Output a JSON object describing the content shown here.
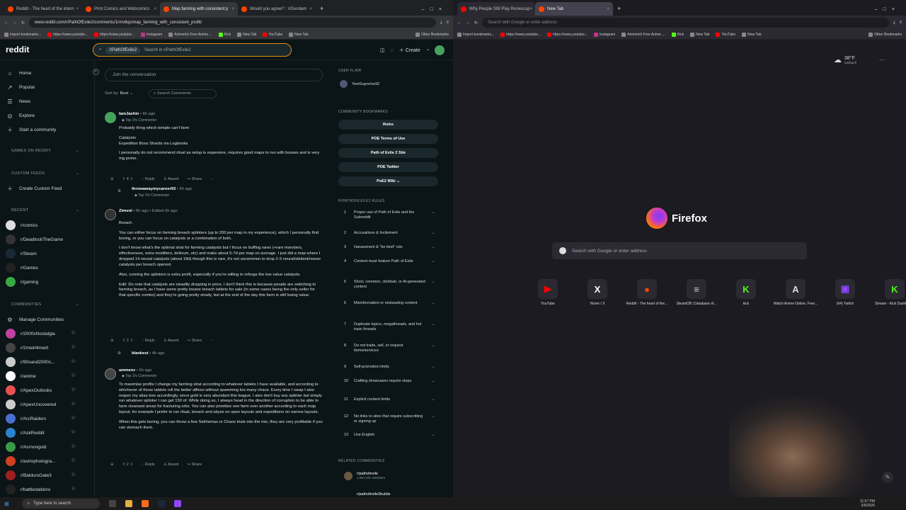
{
  "left_browser": {
    "tabs": [
      {
        "label": "Reddit - The heart of the intern"
      },
      {
        "label": "Print Comics and Webcomics"
      },
      {
        "label": "Map farming with consistent p"
      },
      {
        "label": "Would you agree? : r/Gundam"
      }
    ],
    "url": "www.reddit.com/r/PathOfExile2/comments/1rmv6qc/map_farming_with_consistent_profit/",
    "bookmarks": [
      "Import bookmarks...",
      "https://www.youtube...",
      "https://www.youtube...",
      "Instagram",
      "Animetch Free Anime ...",
      "Kick",
      "New Tab",
      "YouTube",
      "New Tab",
      "Other Bookmarks"
    ]
  },
  "reddit": {
    "logo": "reddit",
    "search_chip": "r/PathOfExile2",
    "search_placeholder": "Search in r/PathOfExile2",
    "create_label": "Create",
    "nav": [
      {
        "label": "Home",
        "icon": "⌂"
      },
      {
        "label": "Popular",
        "icon": "↗"
      },
      {
        "label": "News",
        "icon": "☰"
      },
      {
        "label": "Explore",
        "icon": "◎"
      }
    ],
    "start_community": "Start a community",
    "games_header": "GAMES ON REDDIT",
    "custom_feeds_header": "CUSTOM FEEDS",
    "create_feed": "Create Custom Feed",
    "recent_header": "RECENT",
    "recent": [
      {
        "label": "r/comics",
        "color": "#dddddd"
      },
      {
        "label": "r/DeadlockTheGame",
        "color": "#333333"
      },
      {
        "label": "r/Steam",
        "color": "#1b2838"
      },
      {
        "label": "r/Games",
        "color": "#222222"
      },
      {
        "label": "r/gaming",
        "color": "#3aa843"
      }
    ],
    "communities_header": "COMMUNITIES",
    "manage_label": "Manage Communities",
    "communities": [
      {
        "label": "r/2000sNostalgia",
        "color": "#c040a0"
      },
      {
        "label": "r/2meirl4meirl",
        "color": "#444444"
      },
      {
        "label": "r/90sand2000s...",
        "color": "#cccccc"
      },
      {
        "label": "r/anime",
        "color": "#ffffff"
      },
      {
        "label": "r/ApexOutlooks",
        "color": "#e85050"
      },
      {
        "label": "r/ApexUncovered",
        "color": "#cccccc"
      },
      {
        "label": "r/ArcRaiders",
        "color": "#4a6ed0"
      },
      {
        "label": "r/AskReddit",
        "color": "#2a83d0"
      },
      {
        "label": "r/Asmongold",
        "color": "#3b9a4a"
      },
      {
        "label": "r/astrophotogra...",
        "color": "#d04020"
      },
      {
        "label": "r/BaldursGate3",
        "color": "#a02020"
      },
      {
        "label": "r/battlestations",
        "color": "#222222"
      }
    ]
  },
  "feed": {
    "join": "Join the conversation",
    "sort_label": "Sort by:",
    "sort_value": "Best",
    "search_comments": "Search Comments",
    "comments": [
      {
        "user": "IamJashin",
        "meta": "• 6h ago",
        "tag": "Top 1% Commenter",
        "avatar": "#46a35e",
        "body": [
          "Probably thing which temple can't farm",
          "Catalysts\nExpedition Boss Shards via Logbooks",
          "I personally do not recommend ritual as setup is expensive, requires good maps to run with bosses and is very mg prone."
        ],
        "votes": "4"
      },
      {
        "user": "throwawaymycareer93",
        "meta": "• 5h ago",
        "tag": "Top 1% Commenter",
        "avatar": "#555555",
        "body": [],
        "votes": ""
      },
      {
        "user": "Zimvol",
        "meta": "• 6h ago • Edited 6h ago",
        "tag": "",
        "avatar": "#888888",
        "body": [
          "Breach.",
          "You can either focus on farming breach splinters (up to 200 per map in my experience), which I personally find boring, or you can focus on catalysts or a combination of both.",
          "I don't know what's the optimal strat for farming catalysts but I focus on buffing rares (+rare monsters, effectiveness, extra modifiers, delirium, etc) and make about 5-7d per map on average. I just did a map where I dropped 14 neural catalysts (about 18d) though this is rare, it's not uncommon to drop 2-3 neural/sibilant/reaver catalysts per breach opened.",
          "Also, running the splinters is extra profit, especially if you're willing to reforge the low value catalysts.",
          "Edit: Do note that catalysts are steadily dropping in price. I don't think this is because people are switching to farming breach, as I have some pretty insane breach tablets for sale (in some cases being the only seller for that specific combo) and they're going pretty slowly, but at the end of the day this farm is still losing value."
        ],
        "votes": "2"
      },
      {
        "user": "blankest",
        "meta": "• 4h ago",
        "tag": "",
        "avatar": "#777777",
        "body": [],
        "votes": ""
      },
      {
        "user": "ammenz",
        "meta": "• 6h ago",
        "tag": "Top 1% Commenter",
        "avatar": "#999999",
        "body": [
          "To maximise profits I change my farming strat according to whatever tablets I have available, and according to whichever of those tablets roll the better affixes without spamming too many chaos. Every time I swap I also respec my atlas tree accordingly, since gold is very abundant this league. I also don't buy any splinter but simply run whatever splinter I can get 150 of. While doing so, I always head in the direction of corruption to be able to farm cleansed areas for fracturing orbs. You can also prioritize one farm over another according to each map layout, for example I prefer to run ritual, breach and abyss on open layouts and expeditions on narrow layouts.",
          "When this gets boring, you can throw a few Sekhemas or Chaos trials into the mix, they are very profitable if you can stomach them."
        ],
        "votes": "2"
      }
    ],
    "actions": {
      "reply": "Reply",
      "award": "Award",
      "share": "Share"
    }
  },
  "sidebar_right": {
    "user_flair": "USER FLAIR",
    "flair_user": "YeetSupreme92",
    "bookmarks_header": "COMMUNITY BOOKMARKS",
    "bookmarks": [
      "Rules",
      "POE Terms of Use",
      "Path of Exile 2 Site",
      "POE Twitter",
      "PoE2 Wiki"
    ],
    "rules_header": "R/PATHOFEXILE2 RULES",
    "rules": [
      "Proper use of Path of Exile and the Subreddit",
      "Accusations & Incitement",
      "Harassment & \"be kind\" rule",
      "Content must feature Path of Exile",
      "Short, common, clickbait, or AI-generated content",
      "Misinformation or misleading content",
      "Duplicate topics, megathreads, and hot topic threads",
      "Do not trade, sell, or request items/services",
      "Self-promotion limits",
      "Crafting showcases require steps",
      "Explicit content limits",
      "No links to sites that require subscribing or signing up",
      "Use English"
    ],
    "related_header": "RELATED COMMUNITIES",
    "related": [
      {
        "name": "r/pathofexile",
        "members": "1,057,231 members"
      },
      {
        "name": "r/pathofexile2builds",
        "members": ""
      }
    ]
  },
  "right_browser": {
    "tabs": [
      {
        "label": "Why People Still Play Runescap"
      },
      {
        "label": "New Tab"
      }
    ],
    "url_placeholder": "Search with Google or enter address",
    "bookmarks": [
      "Import bookmarks...",
      "https://www.youtube...",
      "https://www.youtube...",
      "Instagram",
      "Animetch Free Anime ...",
      "Kick",
      "New Tab",
      "YouTube",
      "New Tab",
      "Other Bookmarks"
    ],
    "weather_temp": "38°F",
    "weather_loc": "Kalispell",
    "brand": "Firefox",
    "search_placeholder": "Search with Google or enter address",
    "tiles": [
      {
        "label": "YouTube",
        "glyph": "▶",
        "color": "#ff0000"
      },
      {
        "label": "Home / X",
        "glyph": "X",
        "color": "#ffffff"
      },
      {
        "label": "Reddit - The heart of the...",
        "glyph": "●",
        "color": "#ff4500"
      },
      {
        "label": "SteamDB | Database of...",
        "glyph": "≡",
        "color": "#cccccc"
      },
      {
        "label": "kick",
        "glyph": "K",
        "color": "#53fc18"
      },
      {
        "label": "Watch Anime Online, Free...",
        "glyph": "A",
        "color": "#dddddd"
      },
      {
        "label": "(64) Twitch",
        "glyph": "▣",
        "color": "#9146ff"
      },
      {
        "label": "Stream - Kick Dashboard",
        "glyph": "K",
        "color": "#53fc18"
      }
    ]
  },
  "taskbar": {
    "search": "Type here to search",
    "time": "11:57 PM",
    "date": "3/6/2026"
  }
}
